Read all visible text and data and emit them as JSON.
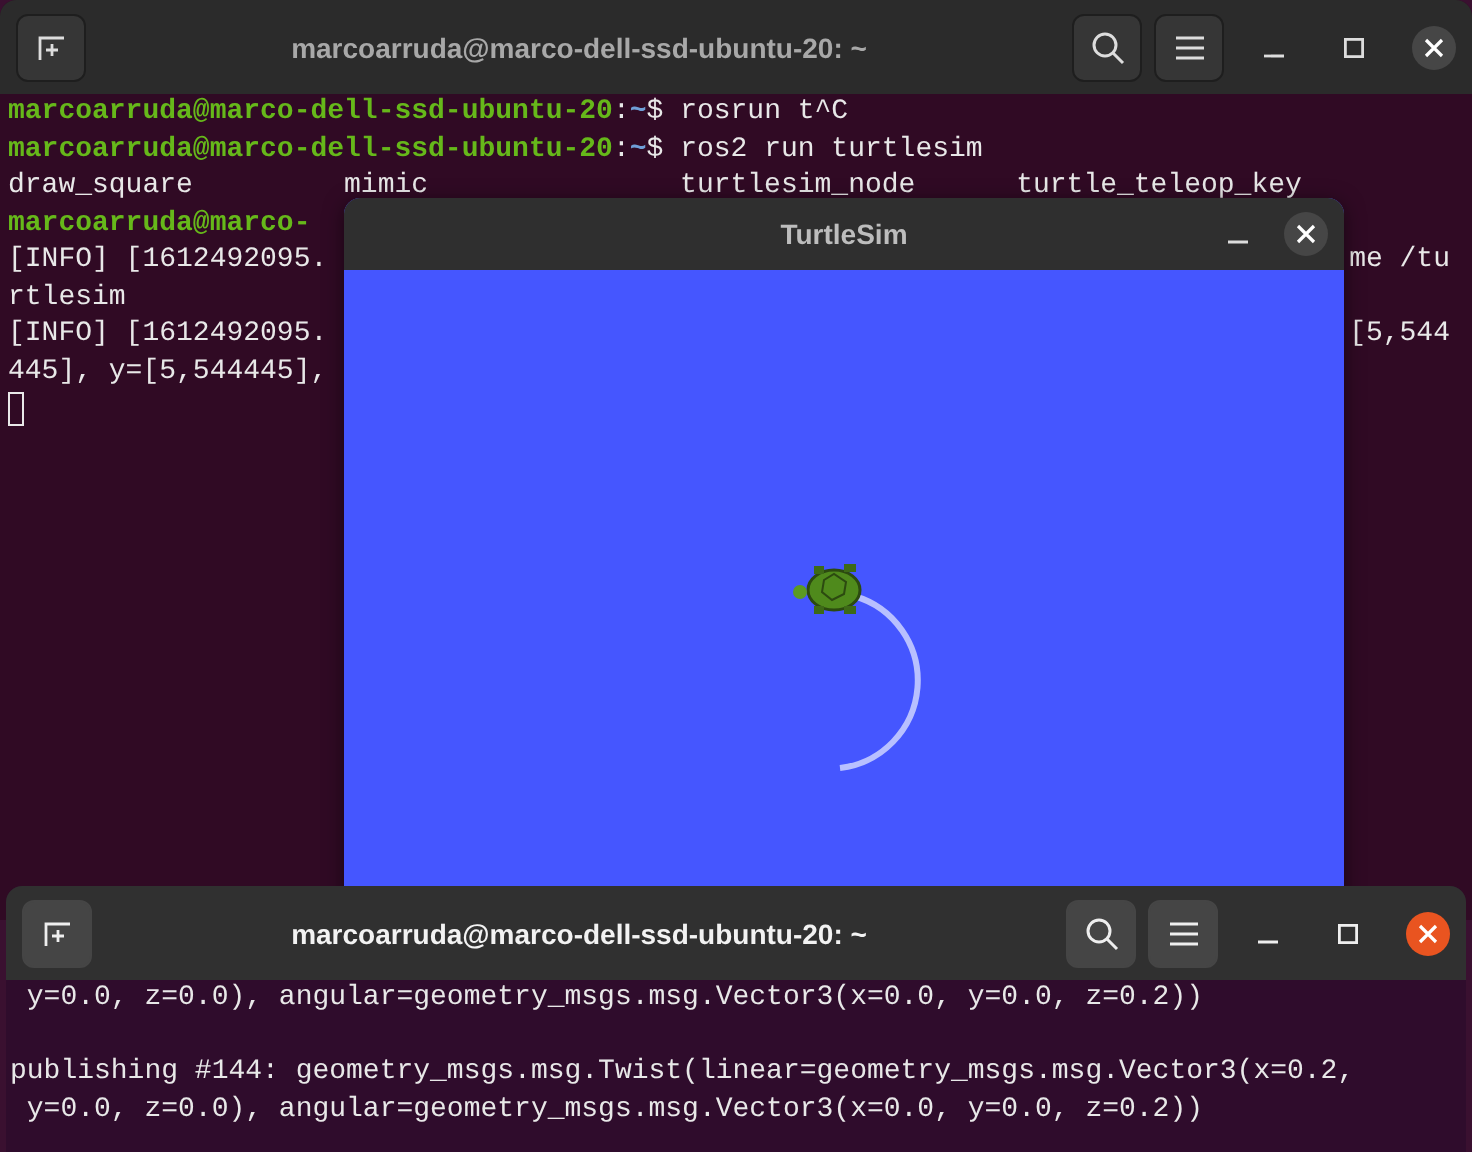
{
  "back_terminal": {
    "title": "marcoarruda@marco-dell-ssd-ubuntu-20: ~",
    "focused": false,
    "lines": [
      {
        "kind": "prompt",
        "user": "marcoarruda@marco-dell-ssd-ubuntu-20",
        "sep": ":",
        "path": "~",
        "dollar": "$",
        "command": " rosrun t^C"
      },
      {
        "kind": "prompt",
        "user": "marcoarruda@marco-dell-ssd-ubuntu-20",
        "sep": ":",
        "path": "~",
        "dollar": "$",
        "command": " ros2 run turtlesim"
      },
      {
        "kind": "output",
        "text": "draw_square         mimic               turtlesim_node      turtle_teleop_key"
      },
      {
        "kind": "user_only",
        "user": "marcoarruda@marco-"
      },
      {
        "kind": "output",
        "text": "[INFO] [1612492095.",
        "right": "me /tu"
      },
      {
        "kind": "output",
        "text": "rtlesim"
      },
      {
        "kind": "output",
        "text": "[INFO] [1612492095.",
        "right": "[5,544"
      },
      {
        "kind": "output",
        "text": "445], y=[5,544445],"
      },
      {
        "kind": "cursor"
      }
    ]
  },
  "turtlesim": {
    "title": "TurtleSim"
  },
  "front_terminal": {
    "title": "marcoarruda@marco-dell-ssd-ubuntu-20: ~",
    "focused": true,
    "lines": [
      {
        "kind": "text",
        "text": " y=0.0, z=0.0), angular=geometry_msgs.msg.Vector3(x=0.0, y=0.0, z=0.2))"
      },
      {
        "kind": "blank"
      },
      {
        "kind": "text",
        "text": "publishing #144: geometry_msgs.msg.Twist(linear=geometry_msgs.msg.Vector3(x=0.2,"
      },
      {
        "kind": "text",
        "text": " y=0.0, z=0.0), angular=geometry_msgs.msg.Vector3(x=0.0, y=0.0, z=0.2))"
      }
    ]
  }
}
